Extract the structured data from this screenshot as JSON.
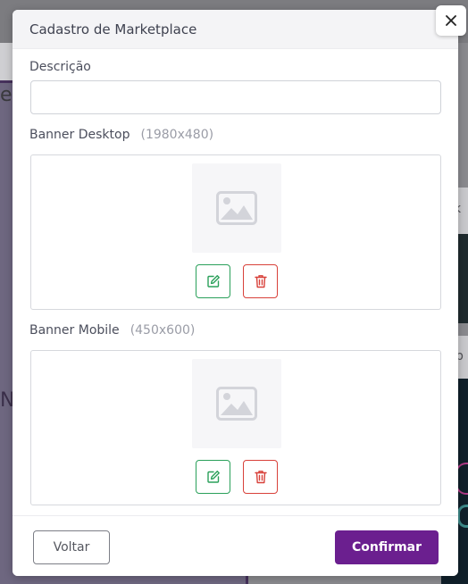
{
  "modal": {
    "title": "Cadastro de Marketplace"
  },
  "form": {
    "description": {
      "label": "Descrição",
      "value": "",
      "placeholder": ""
    },
    "banner_desktop": {
      "label": "Banner Desktop",
      "hint": "(1980x480)"
    },
    "banner_mobile": {
      "label": "Banner Mobile",
      "hint": "(450x600)"
    }
  },
  "footer": {
    "back_label": "Voltar",
    "confirm_label": "Confirmar"
  },
  "background": {
    "partial_text_left_top": "e",
    "partial_text_left_mid": "N",
    "partial_text_right_top": "k",
    "partial_text_right_mid": "b"
  },
  "icons": {
    "close": "close-icon",
    "image_placeholder": "image-icon",
    "edit": "edit-icon",
    "delete": "trash-icon"
  },
  "colors": {
    "primary": "#6b1f8f",
    "edit": "#2aa05a",
    "delete": "#d8413a",
    "overlay": "#8a8a8e"
  }
}
